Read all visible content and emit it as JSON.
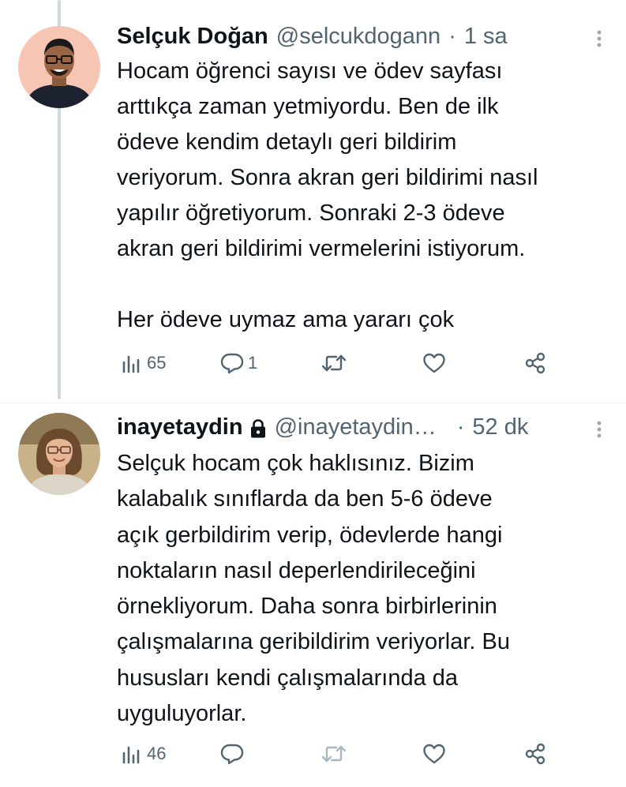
{
  "thread": {
    "tweets": [
      {
        "display_name": "Selçuk Doğan",
        "handle": "@selcukdogann",
        "separator": "·",
        "time": "1 sa",
        "protected": false,
        "text": "Hocam öğrenci sayısı ve ödev sayfası\narttıkça zaman yetmiyordu. Ben de ilk\nödeve kendim detaylı geri bildirim\nveriyorum. Sonra akran geri bildirimi nasıl\nyapılır öğretiyorum. Sonraki 2-3 ödeve\nakran geri bildirimi vermelerini istiyorum.\n\nHer ödeve uymaz ama yararı çok",
        "views": "65",
        "replies": "1",
        "retweets": "",
        "likes": ""
      },
      {
        "display_name": "inayetaydin",
        "handle": "@inayetaydin…",
        "separator": "·",
        "time": "52 dk",
        "protected": true,
        "text": "Selçuk hocam çok haklısınız. Bizim\nkalabalık sınıflarda da ben 5-6 ödeve\naçık gerbildirim verip, ödevlerde hangi\nnoktaların nasıl deperlendirileceğini\nörnekliyorum. Daha sonra birbirlerinin\nçalışmalarına geribildirim veriyorlar. Bu\nhususları kendi çalışmalarında da\nuyguluyorlar.",
        "views": "46",
        "replies": "",
        "retweets": "",
        "likes": ""
      }
    ]
  },
  "colors": {
    "text": "#0f1419",
    "secondary": "#536471",
    "thread_line": "#cfd9de",
    "retweet_disabled": "#aab8c2"
  },
  "icons": {
    "views": "bar-chart-icon",
    "reply": "speech-bubble-icon",
    "retweet": "retweet-arrows-icon",
    "like": "heart-icon",
    "share": "share-nodes-icon",
    "more": "vertical-dots-icon",
    "lock": "lock-icon"
  }
}
